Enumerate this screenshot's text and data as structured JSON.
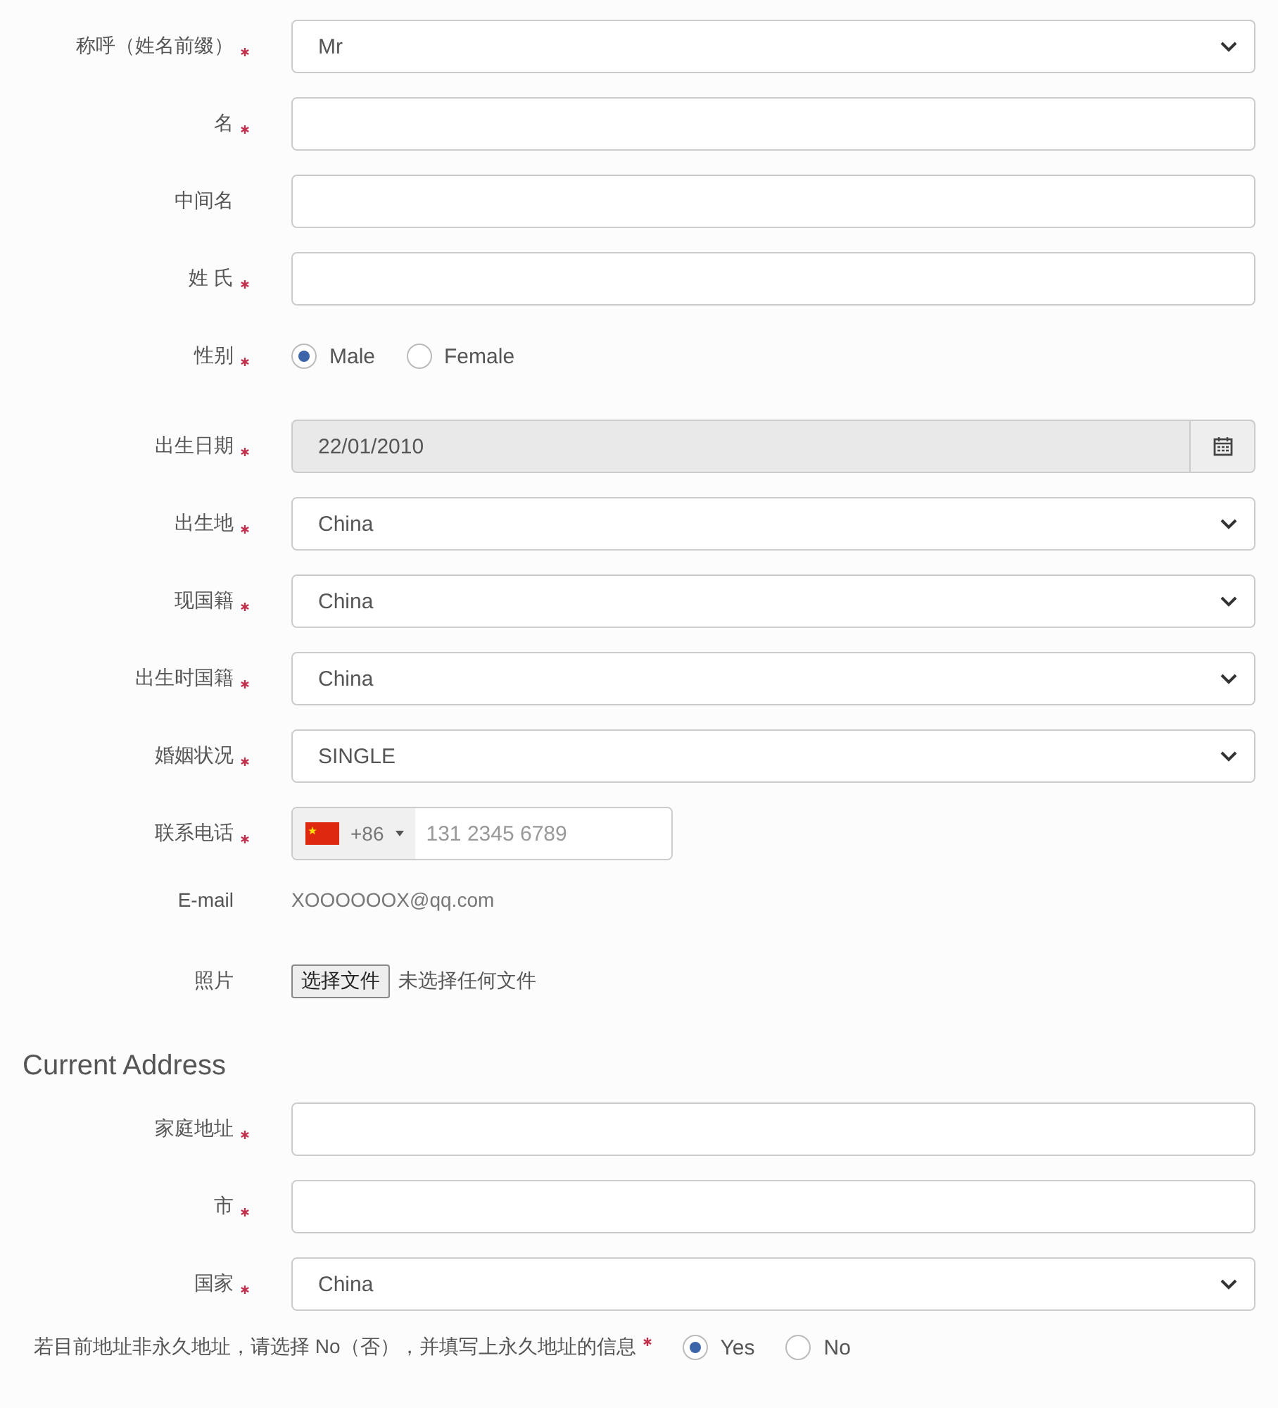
{
  "fields": [
    {
      "label": "称呼（姓名前缀）",
      "required": true,
      "kind": "select",
      "value": "Mr"
    },
    {
      "label": "名",
      "required": true,
      "kind": "text"
    },
    {
      "label": "中间名",
      "required": false,
      "kind": "text"
    },
    {
      "label": "姓 氏",
      "required": true,
      "kind": "text"
    },
    {
      "label": "性别",
      "required": true,
      "kind": "radio",
      "options": [
        {
          "label": "Male",
          "selected": true
        },
        {
          "label": "Female",
          "selected": false
        }
      ]
    },
    {
      "label": "出生日期",
      "required": true,
      "kind": "date",
      "value": "22/01/2010"
    },
    {
      "label": "出生地",
      "required": true,
      "kind": "select",
      "value": "China"
    },
    {
      "label": "现国籍",
      "required": true,
      "kind": "select",
      "value": "China"
    },
    {
      "label": "出生时国籍",
      "required": true,
      "kind": "select",
      "value": "China"
    },
    {
      "label": "婚姻状况",
      "required": true,
      "kind": "select",
      "value": "SINGLE"
    },
    {
      "label": "联系电话",
      "required": true,
      "kind": "phone",
      "code": "+86",
      "placeholder": "131 2345 6789"
    },
    {
      "label": "E-mail",
      "required": false,
      "kind": "static",
      "value": "XOOOOOOX@qq.com"
    },
    {
      "label": "照片",
      "required": false,
      "kind": "file",
      "button": "选择文件",
      "status": "未选择任何文件"
    }
  ],
  "current_address": {
    "heading": "Current Address",
    "fields": [
      {
        "label": "家庭地址",
        "required": true,
        "kind": "text"
      },
      {
        "label": "市",
        "required": true,
        "kind": "text"
      },
      {
        "label": "国家",
        "required": true,
        "kind": "select",
        "value": "China"
      }
    ],
    "permanent_question": {
      "label": "若目前地址非永久地址，请选择 No（否），并填写上永久地址的信息",
      "required": true,
      "options": [
        {
          "label": "Yes",
          "selected": true
        },
        {
          "label": "No",
          "selected": false
        }
      ]
    }
  }
}
